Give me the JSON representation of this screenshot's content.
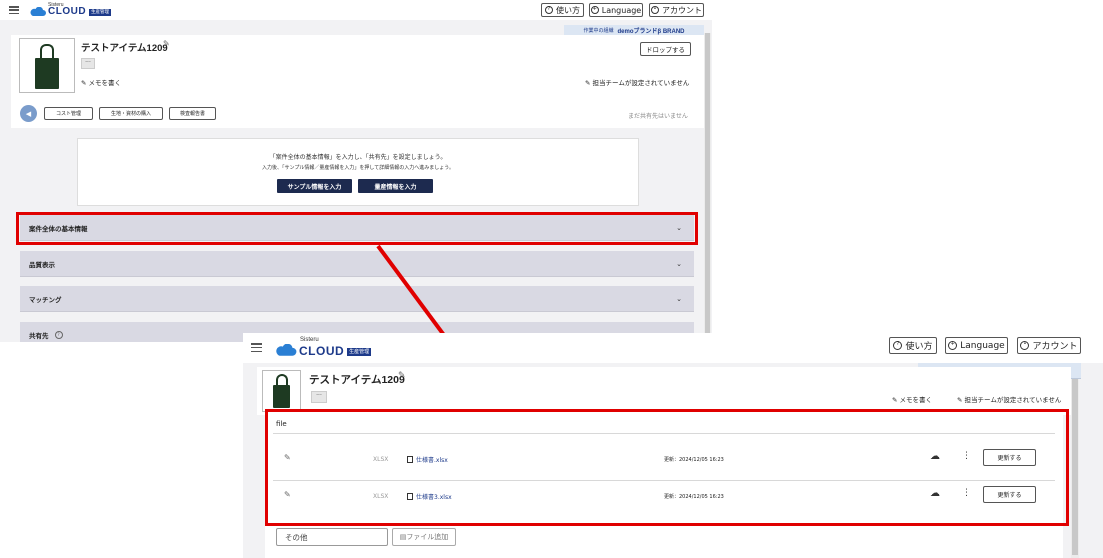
{
  "app": {
    "logo_small": "Sisteru",
    "logo_text": "CLOUD",
    "logo_badge": "生産管理",
    "help_label": "使い方",
    "language_label": "Language",
    "account_label": "アカウント"
  },
  "brand_bar": {
    "prefix": "作業中の組織",
    "name": "demoブランドβ BRAND"
  },
  "item": {
    "title": "テストアイテム1209",
    "memo_label": "メモを書く",
    "team_label": "担当チームが設定されていません",
    "drop_label": "ドロップする",
    "no_share": "まだ共有先はいません"
  },
  "actions": [
    "コスト管理",
    "生地・資材の購入",
    "検査報告書"
  ],
  "message": {
    "line1": "「案件全体の基本情報」を入力し、「共有先」を設定しましょう。",
    "line2": "入力後、「サンプル情報／量産情報を入力」を押して詳細情報の入力へ進みましょう。",
    "sample_button": "サンプル情報を入力",
    "mass_button": "量産情報を入力"
  },
  "sections": [
    "案件全体の基本情報",
    "品質表示",
    "マッチング",
    "共有先"
  ],
  "files": {
    "header": "file",
    "rows": [
      {
        "ext": "XLSX",
        "name": "仕様書.xlsx",
        "updated": "更新：2024/12/05 16:23",
        "button": "更新する"
      },
      {
        "ext": "XLSX",
        "name": "仕様書3.xlsx",
        "updated": "更新：2024/12/05 16:23",
        "button": "更新する"
      }
    ],
    "other_placeholder": "その他",
    "add_file_label": "ファイル追加"
  },
  "colors": {
    "accent_navy": "#1d2a4f",
    "brand_blue": "#1d3a8a",
    "highlight_red": "#e00000",
    "accordion_bg": "#d9d9e3"
  }
}
